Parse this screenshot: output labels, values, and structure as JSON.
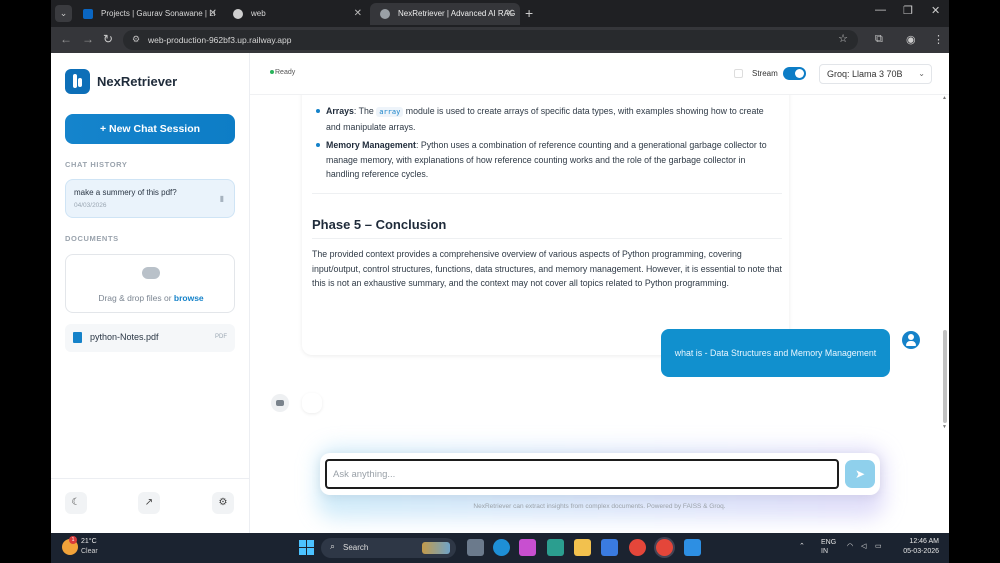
{
  "browser": {
    "tabs": [
      {
        "label": "Projects | Gaurav Sonawane | Li",
        "favicon_color": "#0a66c2",
        "active": false
      },
      {
        "label": "web",
        "favicon_color": "#cfcfcf",
        "active": false
      },
      {
        "label": "NexRetriever | Advanced AI RAG",
        "favicon_color": "#9aa0a6",
        "active": true
      }
    ],
    "url": "web-production-962bf3.up.railway.app"
  },
  "sidebar": {
    "app_name": "NexRetriever",
    "new_chat_label": "+ New Chat Session",
    "chat_history_label": "CHAT HISTORY",
    "history": [
      {
        "title": "make a summery of this pdf?",
        "date": "04/03/2026"
      }
    ],
    "documents_label": "DOCUMENTS",
    "dropzone_text": "Drag & drop files or ",
    "dropzone_link": "browse",
    "documents": [
      {
        "name": "python-Notes.pdf",
        "type": "PDF"
      }
    ]
  },
  "topbar": {
    "status": "Ready",
    "stream_label": "Stream",
    "stream_on": true,
    "model": "Groq: Llama 3 70B"
  },
  "chat": {
    "bullets": [
      {
        "term": "Arrays",
        "pre": ": The ",
        "code": "array",
        "post": " module is used to create arrays of specific data types, with examples showing how to create and manipulate arrays."
      },
      {
        "term": "Memory Management",
        "pre": ": Python uses a combination of reference counting and a generational garbage collector to manage memory, with explanations of how reference counting works and the role of the garbage collector in handling reference cycles.",
        "code": "",
        "post": ""
      }
    ],
    "section_title": "Phase 5 – Conclusion",
    "conclusion": "The provided context provides a comprehensive overview of various aspects of Python programming, covering input/output, control structures, functions, data structures, and memory management. However, it is essential to note that this is not an exhaustive summary, and the context may not cover all topics related to Python programming.",
    "user_message": "what is - Data Structures and Memory Management"
  },
  "composer": {
    "placeholder": "Ask anything...",
    "footer": "NexRetriever can extract insights from complex documents. Powered by FAISS & Groq."
  },
  "taskbar": {
    "temperature": "21°C",
    "weather": "Clear",
    "weather_badge": "1",
    "search_label": "Search",
    "lang_line1": "ENG",
    "lang_line2": "IN",
    "time": "12:46 AM",
    "date": "05-03-2026"
  },
  "colors": {
    "accent": "#1582c9",
    "user_bubble": "#1190ce",
    "status_ready": "#29b35b"
  }
}
